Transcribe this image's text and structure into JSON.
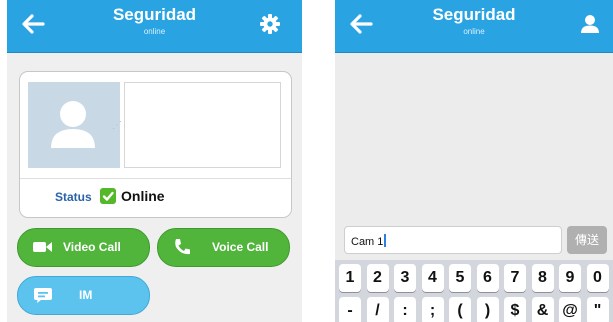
{
  "colors": {
    "header": "#2aa3e2",
    "green_button": "#51b53c",
    "blue_button": "#5cc3ef",
    "status_green": "#55b82a"
  },
  "left_screen": {
    "header": {
      "title": "Seguridad",
      "subtitle": "online",
      "left_icon": "back-arrow-icon",
      "right_icon": "gear-icon"
    },
    "card": {
      "status_label": "Status",
      "status_value": "Online",
      "status_icon": "check-icon"
    },
    "buttons": {
      "video_call": {
        "label": "Video Call",
        "icon": "video-camera-icon"
      },
      "voice_call": {
        "label": "Voice Call",
        "icon": "phone-icon"
      },
      "im": {
        "label": "IM",
        "icon": "chat-bubble-icon"
      }
    }
  },
  "right_screen": {
    "header": {
      "title": "Seguridad",
      "subtitle": "online",
      "left_icon": "back-arrow-icon",
      "right_icon": "person-icon"
    },
    "input": {
      "value": "Cam 1"
    },
    "send_label": "傳送",
    "keyboard": {
      "row1": [
        "1",
        "2",
        "3",
        "4",
        "5",
        "6",
        "7",
        "8",
        "9",
        "0"
      ],
      "row2": [
        "-",
        "/",
        ":",
        ";",
        "(",
        ")",
        "$",
        "&",
        "@",
        "\""
      ]
    }
  }
}
